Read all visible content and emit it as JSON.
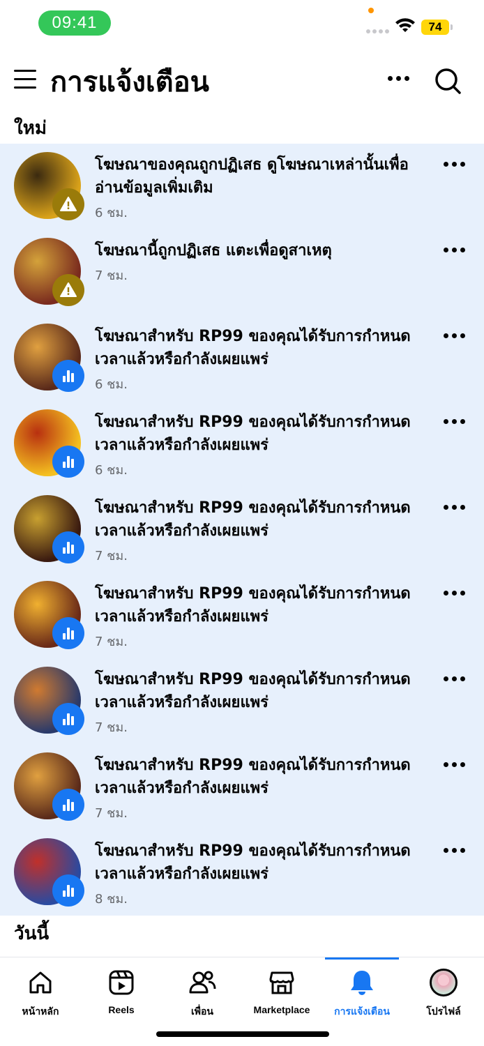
{
  "status_bar": {
    "time": "09:41",
    "battery": "74"
  },
  "header": {
    "title": "การแจ้งเตือน"
  },
  "sections": {
    "new": "ใหม่",
    "today": "วันนี้"
  },
  "notifications": [
    {
      "text": "โฆษณาของคุณถูกปฏิเสธ ดูโฆษณาเหล่านั้นเพื่ออ่านข้อมูลเพิ่มเติม",
      "time": "6 ชม.",
      "badge": "warning-icon",
      "colors": [
        "#d9a21a",
        "#3b2a10"
      ]
    },
    {
      "text": "โฆษณานี้ถูกปฏิเสธ แตะเพื่อดูสาเหตุ",
      "time": "7 ชม.",
      "badge": "warning-icon",
      "colors": [
        "#7a2b1e",
        "#d4a23a"
      ]
    },
    {
      "text": "โฆษณาสำหรับ RP99 ของคุณได้รับการกำหนดเวลาแล้วหรือกำลังเผยแพร่",
      "time": "6 ชม.",
      "badge": "bar-chart-icon",
      "colors": [
        "#5a2a1a",
        "#e0a040"
      ]
    },
    {
      "text": "โฆษณาสำหรับ RP99 ของคุณได้รับการกำหนดเวลาแล้วหรือกำลังเผยแพร่",
      "time": "6 ชม.",
      "badge": "bar-chart-icon",
      "colors": [
        "#f4c020",
        "#b83010"
      ]
    },
    {
      "text": "โฆษณาสำหรับ RP99 ของคุณได้รับการกำหนดเวลาแล้วหรือกำลังเผยแพร่",
      "time": "7 ชม.",
      "badge": "bar-chart-icon",
      "colors": [
        "#3a1a10",
        "#c8a030"
      ]
    },
    {
      "text": "โฆษณาสำหรับ RP99 ของคุณได้รับการกำหนดเวลาแล้วหรือกำลังเผยแพร่",
      "time": "7 ชม.",
      "badge": "bar-chart-icon",
      "colors": [
        "#6a2a18",
        "#f0b030"
      ]
    },
    {
      "text": "โฆษณาสำหรับ RP99 ของคุณได้รับการกำหนดเวลาแล้วหรือกำลังเผยแพร่",
      "time": "7 ชม.",
      "badge": "bar-chart-icon",
      "colors": [
        "#2a3a6a",
        "#d07a30"
      ]
    },
    {
      "text": "โฆษณาสำหรับ RP99 ของคุณได้รับการกำหนดเวลาแล้วหรือกำลังเผยแพร่",
      "time": "7 ชม.",
      "badge": "bar-chart-icon",
      "colors": [
        "#5a2a1a",
        "#e0a040"
      ]
    },
    {
      "text": "โฆษณาสำหรับ RP99 ของคุณได้รับการกำหนดเวลาแล้วหรือกำลังเผยแพร่",
      "time": "8 ชม.",
      "badge": "bar-chart-icon",
      "colors": [
        "#2a4aa0",
        "#c0302a"
      ]
    }
  ],
  "nav": [
    {
      "label": "หน้าหลัก",
      "icon": "home-icon"
    },
    {
      "label": "Reels",
      "icon": "reels-icon"
    },
    {
      "label": "เพื่อน",
      "icon": "friends-icon"
    },
    {
      "label": "Marketplace",
      "icon": "marketplace-icon"
    },
    {
      "label": "การแจ้งเตือน",
      "icon": "bell-icon",
      "active": true
    },
    {
      "label": "โปรไฟล์",
      "icon": "profile-avatar"
    }
  ],
  "accent_color": "#1877f2"
}
